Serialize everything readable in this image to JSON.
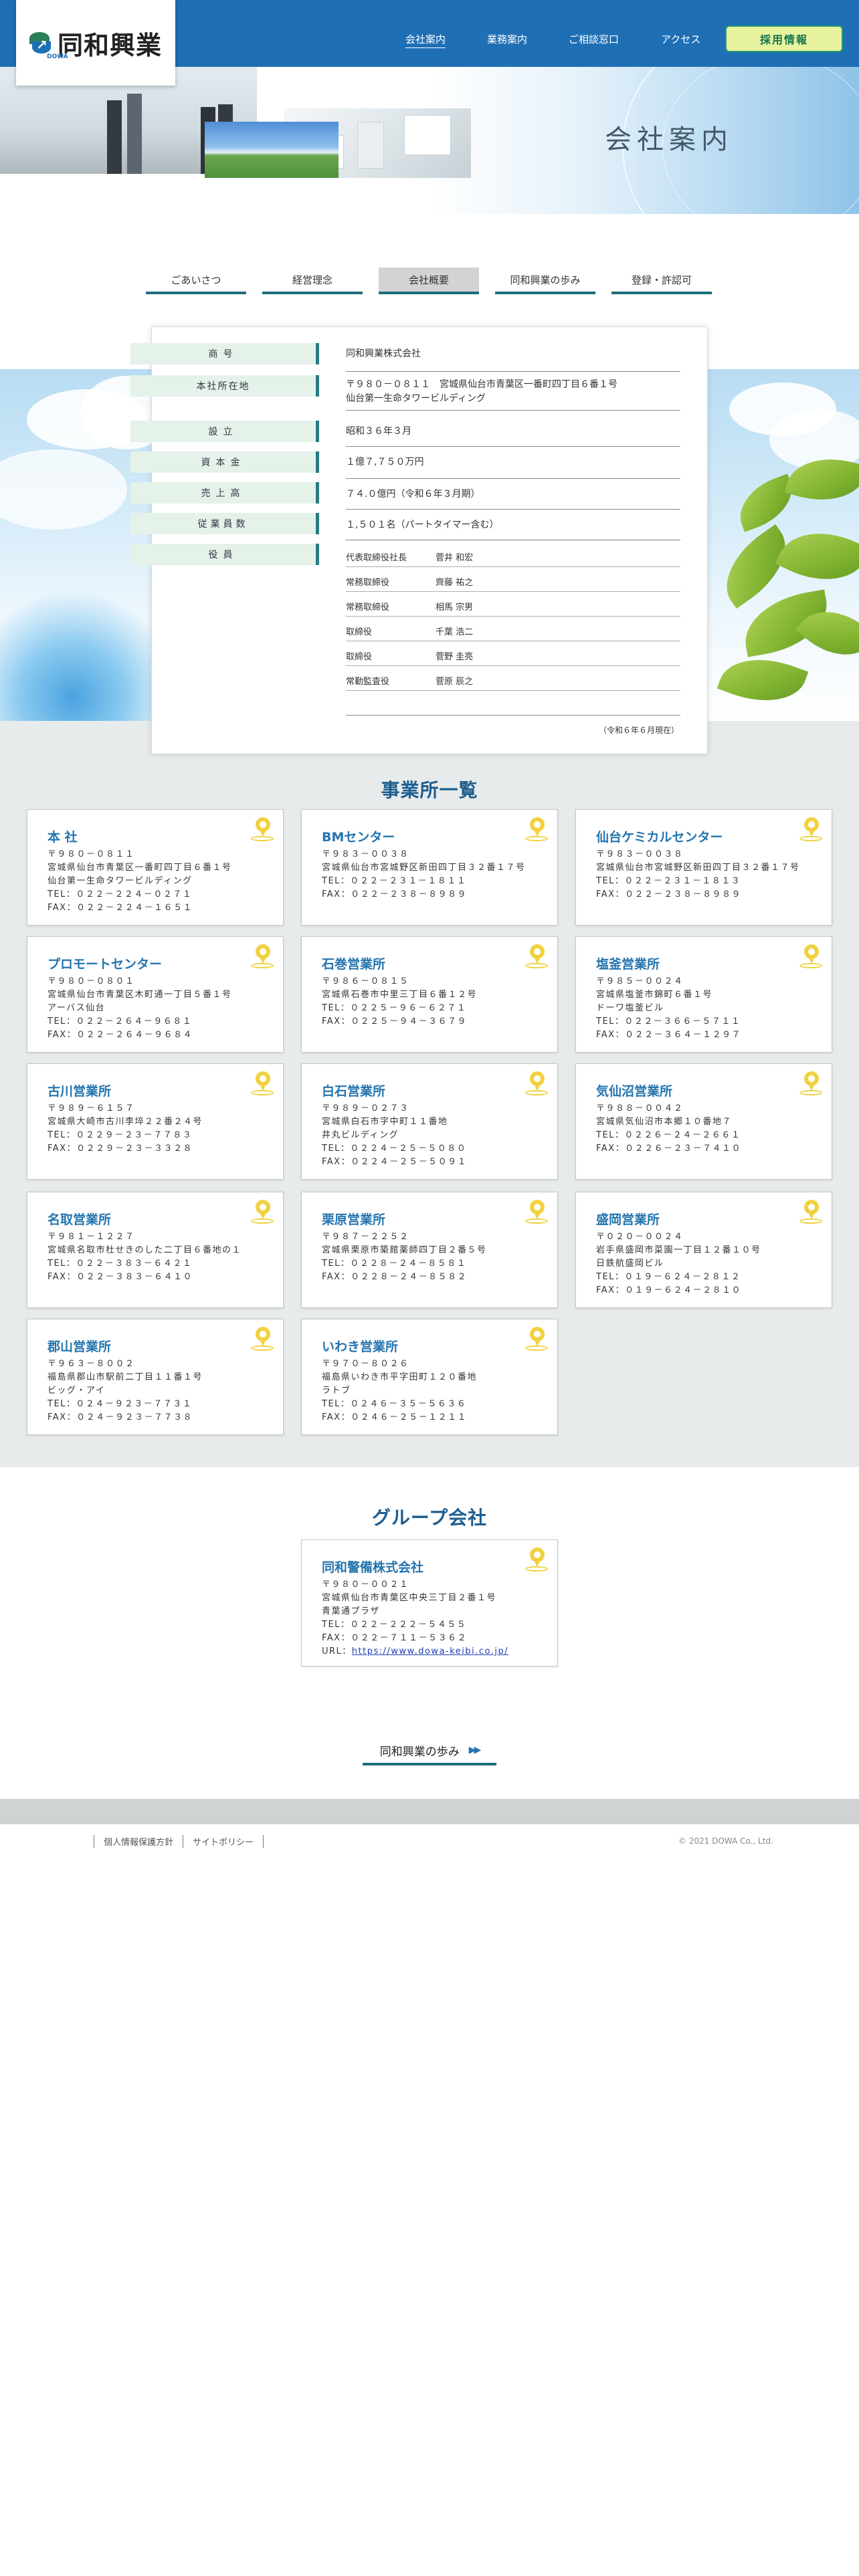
{
  "header": {
    "logo_text": "同和興業",
    "logo_sub": "DOWA",
    "nav": [
      {
        "label": "会社案内",
        "active": true
      },
      {
        "label": "業務案内",
        "active": false
      },
      {
        "label": "ご相談窓口",
        "active": false
      },
      {
        "label": "アクセス",
        "active": false
      }
    ],
    "recruit_label": "採用情報"
  },
  "hero": {
    "title": "会社案内"
  },
  "tabs": [
    {
      "label": "ごあいさつ",
      "active": false
    },
    {
      "label": "経営理念",
      "active": false
    },
    {
      "label": "会社概要",
      "active": true
    },
    {
      "label": "同和興業の歩み",
      "active": false
    },
    {
      "label": "登録・許認可",
      "active": false
    }
  ],
  "overview": {
    "rows": [
      {
        "label": "商号",
        "value": "同和興業株式会社"
      },
      {
        "label": "本社所在地",
        "value": "〒９８０－０８１１　宮城県仙台市青葉区一番町四丁目６番１号",
        "value2": "仙台第一生命タワービルディング"
      },
      {
        "label": "設立",
        "value": "昭和３６年３月"
      },
      {
        "label": "資本金",
        "value": "１億７,７５０万円"
      },
      {
        "label": "売上高",
        "value": "７４.０億円（令和６年３月期）"
      },
      {
        "label": "従業員数",
        "value": "１,５０１名（パートタイマー含む）"
      },
      {
        "label": "役員",
        "value": ""
      }
    ],
    "officers": [
      {
        "role": "代表取締役社長",
        "name": "菅井 和宏"
      },
      {
        "role": "常務取締役",
        "name": "齊藤 祐之"
      },
      {
        "role": "常務取締役",
        "name": "相馬 宗男"
      },
      {
        "role": "取締役",
        "name": "千葉 浩二"
      },
      {
        "role": "取締役",
        "name": "菅野 圭亮"
      },
      {
        "role": "常勤監査役",
        "name": "菅原 辰之"
      }
    ],
    "as_of": "（令和６年６月現在）"
  },
  "offices_title": "事業所一覧",
  "offices": [
    {
      "name": "本 社",
      "lines": [
        "〒９８０－０８１１",
        "宮城県仙台市青葉区一番町四丁目６番１号",
        "仙台第一生命タワービルディング",
        "TEL：０２２－２２４－０２７１",
        "FAX：０２２－２２４－１６５１"
      ]
    },
    {
      "name": "BMセンター",
      "lines": [
        "〒９８３－００３８",
        "宮城県仙台市宮城野区新田四丁目３２番１７号",
        "TEL：０２２－２３１－１８１１",
        "FAX：０２２－２３８－８９８９"
      ]
    },
    {
      "name": "仙台ケミカルセンター",
      "lines": [
        "〒９８３－００３８",
        "宮城県仙台市宮城野区新田四丁目３２番１７号",
        "TEL：０２２－２３１－１８１３",
        "FAX：０２２－２３８－８９８９"
      ]
    },
    {
      "name": "プロモートセンター",
      "lines": [
        "〒９８０－０８０１",
        "宮城県仙台市青葉区木町通一丁目５番１号",
        "アーバス仙台",
        "TEL：０２２－２６４－９６８１",
        "FAX：０２２－２６４－９６８４"
      ]
    },
    {
      "name": "石巻営業所",
      "lines": [
        "〒９８６－０８１５",
        "宮城県石巻市中里三丁目６番１２号",
        "TEL：０２２５－９６－６２７１",
        "FAX：０２２５－９４－３６７９"
      ]
    },
    {
      "name": "塩釜営業所",
      "lines": [
        "〒９８５－００２４",
        "宮城県塩釜市錦町６番１号",
        "ドーワ塩釜ビル",
        "TEL：０２２－３６６－５７１１",
        "FAX：０２２－３６４－１２９７"
      ]
    },
    {
      "name": "古川営業所",
      "lines": [
        "〒９８９－６１５７",
        "宮城県大崎市古川李埣２２番２４号",
        "TEL：０２２９－２３－７７８３",
        "FAX：０２２９－２３－３３２８"
      ]
    },
    {
      "name": "白石営業所",
      "lines": [
        "〒９８９－０２７３",
        "宮城県白石市字中町１１番地",
        "井丸ビルディング",
        "TEL：０２２４－２５－５０８０",
        "FAX：０２２４－２５－５０９１"
      ]
    },
    {
      "name": "気仙沼営業所",
      "lines": [
        "〒９８８－００４２",
        "宮城県気仙沼市本郷１０番地７",
        "TEL：０２２６－２４－２６６１",
        "FAX：０２２６－２３－７４１０"
      ]
    },
    {
      "name": "名取営業所",
      "lines": [
        "〒９８１－１２２７",
        "宮城県名取市杜せきのした二丁目６番地の１",
        "TEL：０２２－３８３－６４２１",
        "FAX：０２２－３８３－６４１０"
      ]
    },
    {
      "name": "栗原営業所",
      "lines": [
        "〒９８７－２２５２",
        "宮城県栗原市築館薬師四丁目２番５号",
        "TEL：０２２８－２４－８５８１",
        "FAX：０２２８－２４－８５８２"
      ]
    },
    {
      "name": "盛岡営業所",
      "lines": [
        "〒０２０－００２４",
        "岩手県盛岡市菜園一丁目１２番１０号",
        "日鉄航盛岡ビル",
        "TEL：０１９－６２４－２８１２",
        "FAX：０１９－６２４－２８１０"
      ]
    },
    {
      "name": "郡山営業所",
      "lines": [
        "〒９６３－８００２",
        "福島県郡山市駅前二丁目１１番１号",
        "ビッグ・アイ",
        "TEL：０２４－９２３－７７３１",
        "FAX：０２４－９２３－７７３８"
      ]
    },
    {
      "name": "いわき営業所",
      "lines": [
        "〒９７０－８０２６",
        "福島県いわき市平字田町１２０番地",
        "ラトブ",
        "TEL：０２４６－３５－５６３６",
        "FAX：０２４６－２５－１２１１"
      ]
    }
  ],
  "group_title": "グループ会社",
  "group": {
    "name": "同和警備株式会社",
    "lines": [
      "〒９８０－００２１",
      "宮城県仙台市青葉区中央三丁目２番１号",
      "青葉通プラザ",
      "TEL：０２２－２２２－５４５５",
      "FAX：０２２－７１１－５３６２"
    ],
    "url_label": "URL：",
    "url": "https://www.dowa-keibi.co.jp/"
  },
  "history_link": "同和興業の歩み",
  "footer": {
    "links": [
      "個人情報保護方針",
      "サイトポリシー"
    ],
    "copyright": "© 2021 DOWA Co., Ltd."
  },
  "colors": {
    "header_blue": "#1f6fb5",
    "accent_teal": "#1e6d7a",
    "office_name_blue": "#2474ae",
    "recruit_bg": "#e8f39f",
    "pin_yellow": "#f1d13f"
  }
}
